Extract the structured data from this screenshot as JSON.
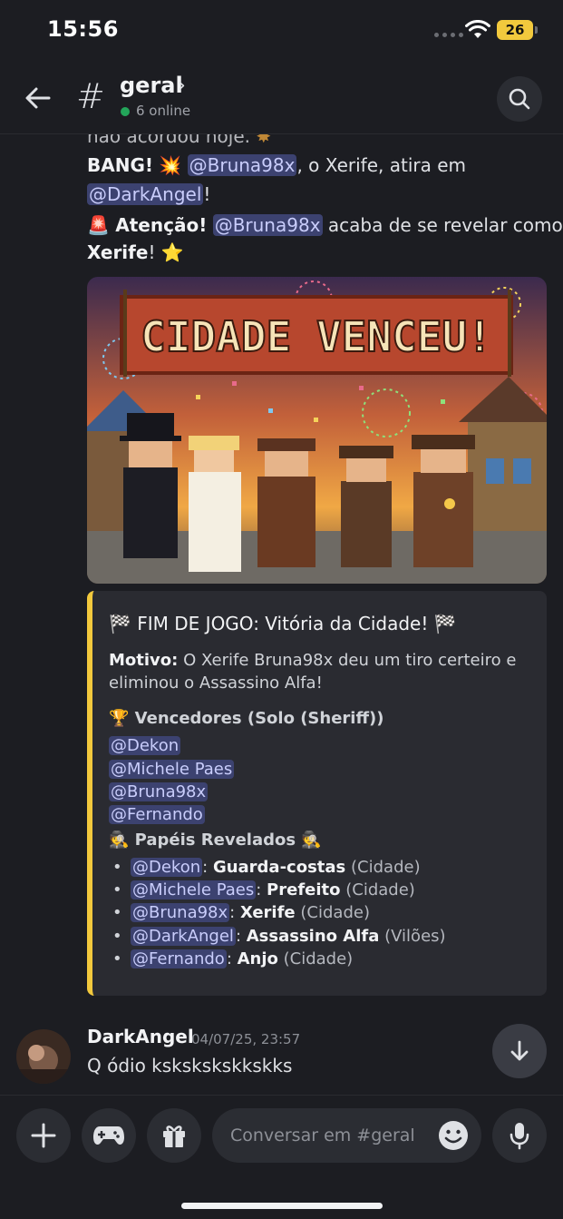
{
  "status_bar": {
    "time": "15:56",
    "battery": "26"
  },
  "header": {
    "channel": "geral",
    "online": "6 online"
  },
  "messages": {
    "clipped_line": "não acordou hoje.",
    "bang": {
      "prefix": "BANG!",
      "emoji": "💥",
      "mention1": "@Bruna98x",
      "middle": ", o Xerife, atira em",
      "mention2": "@DarkAngel",
      "suffix": "!"
    },
    "reveal": {
      "emoji": "🚨",
      "prefix": "Atenção!",
      "mention": "@Bruna98x",
      "middle": "acaba de se revelar como o",
      "role": "Xerife",
      "suffix": "!",
      "star": "⭐"
    },
    "image_banner": "CIDADE VENCEU!",
    "embed": {
      "title": "🏁 FIM DE JOGO: Vitória da Cidade! 🏁",
      "reason_label": "Motivo:",
      "reason_line1": "O Xerife Bruna98x deu um tiro certeiro e",
      "reason_line2": "eliminou o Assassino Alfa!",
      "winners_title": "🏆 Vencedores (Solo (Sheriff))",
      "winners": [
        "@Dekon",
        "@Michele Paes",
        "@Bruna98x",
        "@Fernando"
      ],
      "roles_title": "🕵️ Papéis Revelados 🕵️",
      "roles": [
        {
          "user": "@Dekon",
          "role": "Guarda-costas",
          "team": "(Cidade)"
        },
        {
          "user": "@Michele Paes",
          "role": "Prefeito",
          "team": "(Cidade)"
        },
        {
          "user": "@Bruna98x",
          "role": "Xerife",
          "team": "(Cidade)"
        },
        {
          "user": "@DarkAngel",
          "role": "Assassino Alfa",
          "team": "(Vilões)"
        },
        {
          "user": "@Fernando",
          "role": "Anjo",
          "team": "(Cidade)"
        }
      ]
    },
    "last": {
      "author": "DarkAngel",
      "timestamp": "04/07/25, 23:57",
      "text": "Q ódio kskskskskkskks"
    }
  },
  "composer": {
    "placeholder": "Conversar em #geral"
  },
  "colors": {
    "mention_bg": "#3c4270",
    "embed_accent": "#f2c93d",
    "online": "#23a55a"
  }
}
